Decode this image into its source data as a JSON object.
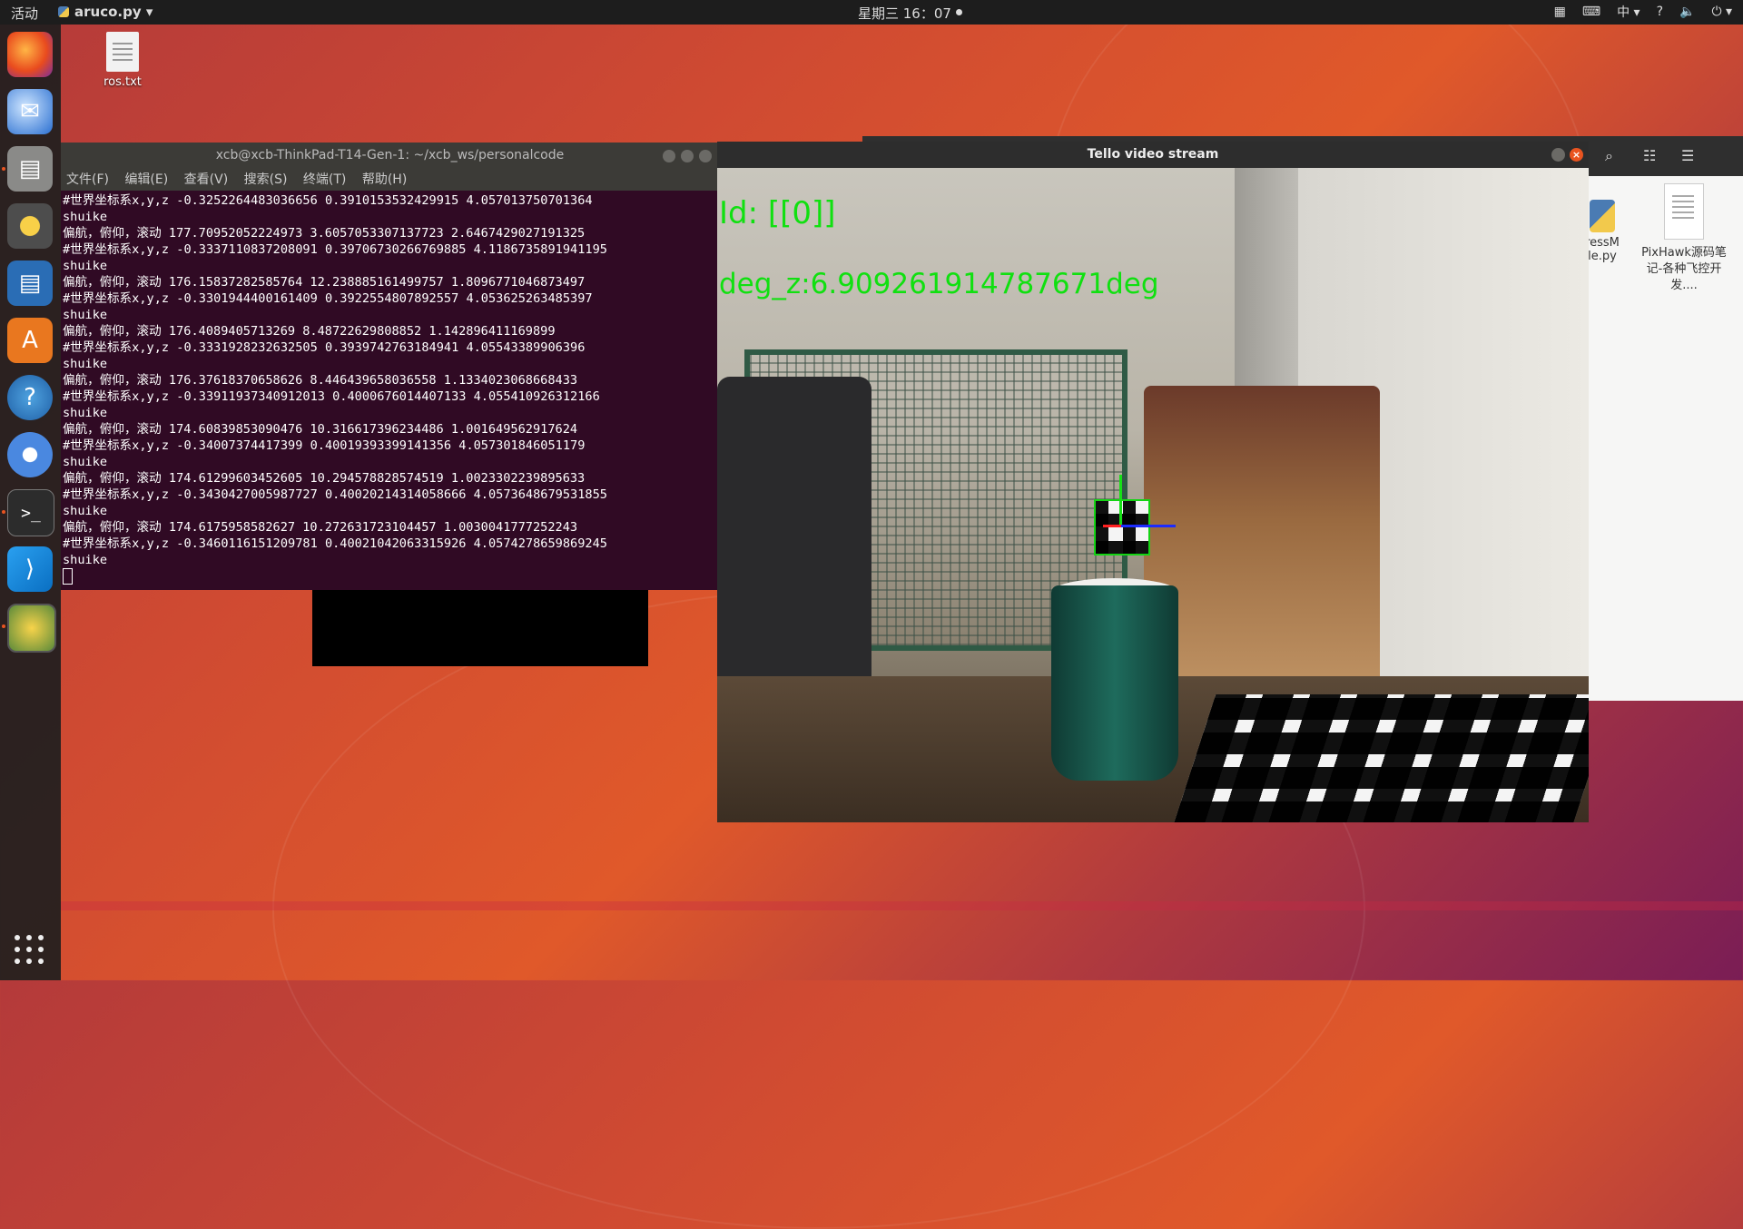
{
  "topbar": {
    "activities": "活动",
    "app_name": "aruco.py",
    "clock": "星期三 16：07",
    "input_method": "中",
    "tray_help": "?",
    "tray_volume": "🔈",
    "tray_power": "⏻"
  },
  "desktop": {
    "file_label": "ros.txt"
  },
  "dock": {
    "items": [
      "firefox-icon",
      "thunderbird-icon",
      "files-icon",
      "rhythmbox-icon",
      "writer-icon",
      "software-icon",
      "help-icon",
      "chromium-icon",
      "terminal-icon",
      "vscode-icon",
      "pycharm-icon"
    ]
  },
  "terminal": {
    "title": "xcb@xcb-ThinkPad-T14-Gen-1: ~/xcb_ws/personalcode",
    "menu": [
      "文件(F)",
      "编辑(E)",
      "查看(V)",
      "搜索(S)",
      "终端(T)",
      "帮助(H)"
    ],
    "lines": [
      "#世界坐标系x,y,z -0.3252264483036656 0.3910153532429915 4.057013750701364",
      "shuike",
      "偏航，俯仰，滚动 177.70952052224973 3.6057053307137723 2.6467429027191325",
      "#世界坐标系x,y,z -0.3337110837208091 0.39706730266769885 4.1186735891941195",
      "shuike",
      "偏航，俯仰，滚动 176.15837282585764 12.238885161499757 1.8096771046873497",
      "#世界坐标系x,y,z -0.3301944400161409 0.3922554807892557 4.053625263485397",
      "shuike",
      "偏航，俯仰，滚动 176.4089405713269 8.48722629808852 1.142896411169899",
      "#世界坐标系x,y,z -0.3331928232632505 0.3939742763184941 4.05543389906396",
      "shuike",
      "偏航，俯仰，滚动 176.37618370658626 8.446439658036558 1.1334023068668433",
      "#世界坐标系x,y,z -0.33911937340912013 0.4000676014407133 4.055410926312166",
      "shuike",
      "偏航，俯仰，滚动 174.60839853090476 10.316617396234486 1.001649562917624",
      "#世界坐标系x,y,z -0.34007374417399 0.40019393399141356 4.057301846051179",
      "shuike",
      "偏航，俯仰，滚动 174.61299603452605 10.294578828574519 1.0023302239895633",
      "#世界坐标系x,y,z -0.3430427005987727 0.40020214314058666 4.0573648679531855",
      "shuike",
      "偏航，俯仰，滚动 174.6175958582627 10.272631723104457 1.0030041777252243",
      "#世界坐标系x,y,z -0.3460116151209781 0.40021042063315926 4.0574278659869245",
      "shuike"
    ]
  },
  "video": {
    "title": "Tello video stream",
    "overlay_id": "Id: [[0]]",
    "overlay_deg": "deg_z:6.909261914787671deg"
  },
  "file_manager": {
    "py_file_label": "ressM\nle.py",
    "pdf_file_label": "PixHawk源码笔记-各种飞控开发...."
  }
}
